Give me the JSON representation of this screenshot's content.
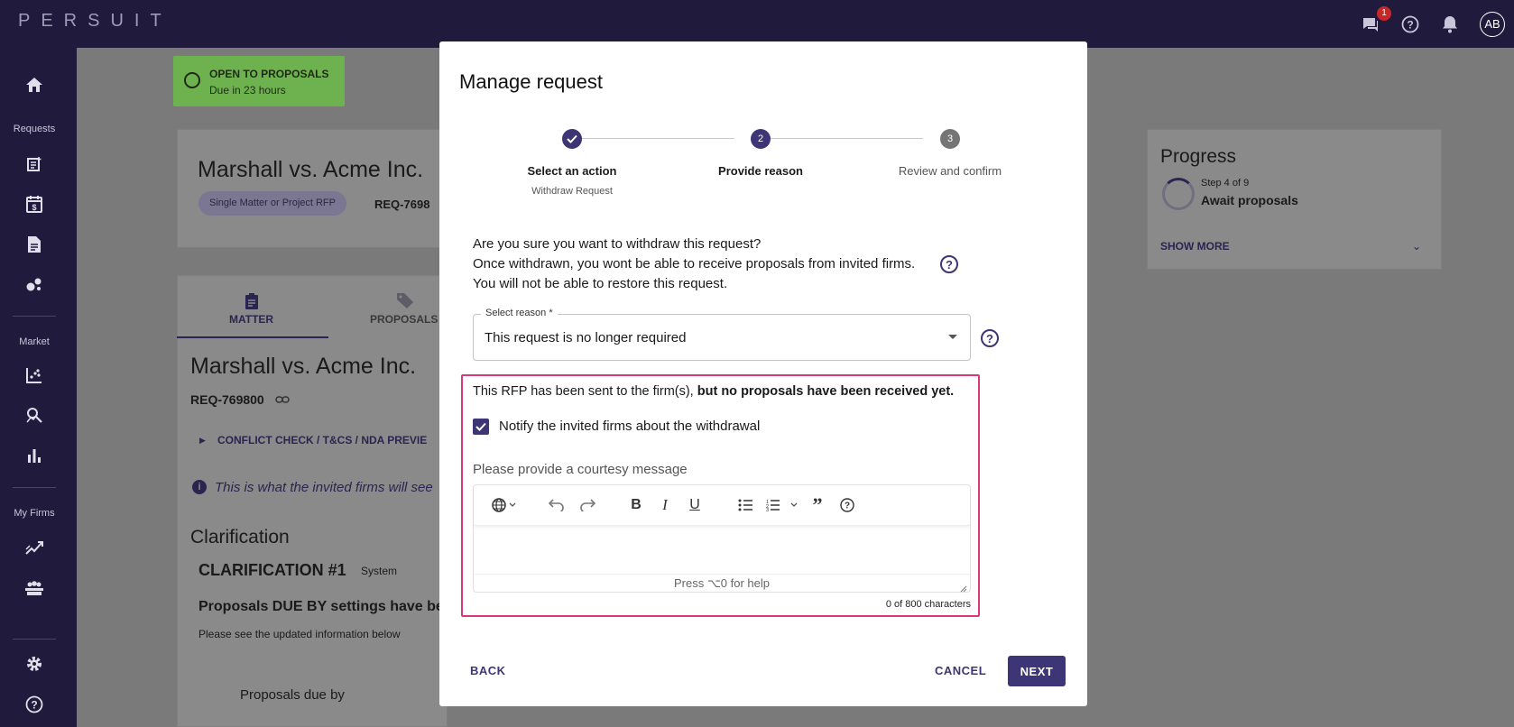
{
  "brand": {
    "logo": "PERSUIT"
  },
  "topbar": {
    "messages_badge": "1",
    "avatar_initials": "AB"
  },
  "sidebar": {
    "sections": [
      "Requests",
      "Market",
      "My Firms"
    ]
  },
  "background": {
    "status_title": "OPEN TO PROPOSALS",
    "status_due": "Due in 23 hours",
    "matter_title": "Marshall vs. Acme Inc.",
    "matter_chip": "Single Matter or Project RFP",
    "req_id_short": "REQ-7698",
    "tab_matter": "MATTER",
    "tab_proposals": "PROPOSALS",
    "matter_title_2": "Marshall vs. Acme Inc.",
    "req_id": "REQ-769800",
    "conflict_link": "CONFLICT CHECK / T&CS / NDA PREVIE",
    "info_text": "This is what the invited firms will see",
    "clarification_heading": "Clarification",
    "clarification_item": "CLARIFICATION #1",
    "clarification_tag": "System",
    "proposals_due_heading": "Proposals DUE BY settings have be",
    "updated_info": "Please see the updated information below",
    "table_cell": "Proposals due by",
    "progress_title": "Progress",
    "progress_step": "Step 4 of 9",
    "progress_name": "Await proposals",
    "show_more": "SHOW MORE"
  },
  "modal": {
    "title": "Manage request",
    "steps": [
      {
        "label": "Select an action",
        "sub": "Withdraw Request",
        "state": "done"
      },
      {
        "number": "2",
        "label": "Provide reason",
        "state": "active"
      },
      {
        "number": "3",
        "label": "Review and confirm",
        "state": "pending"
      }
    ],
    "confirm_line1": "Are you sure you want to withdraw this request?",
    "confirm_line2": "Once withdrawn, you wont be able to receive proposals from invited firms.",
    "confirm_line3": "You will not be able to restore this request.",
    "select": {
      "label": "Select reason *",
      "value": "This request is no longer required"
    },
    "rfp_notice_normal": "This RFP has been sent to the firm(s), ",
    "rfp_notice_bold": "but no proposals have been received yet.",
    "notify_label": "Notify the invited firms about the withdrawal",
    "notify_checked": true,
    "courtesy_label": "Please provide a courtesy message",
    "editor_help": "Press ⌥0 for help",
    "char_count": "0 of 800 characters",
    "back_label": "BACK",
    "cancel_label": "CANCEL",
    "next_label": "NEXT"
  },
  "colors": {
    "primary": "#3d3575",
    "navbar": "#201b3d",
    "status_green": "#6eb24f",
    "highlight_pink": "#d9397a"
  }
}
